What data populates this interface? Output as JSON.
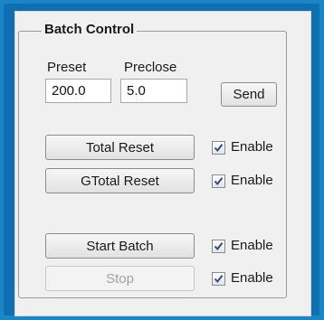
{
  "group": {
    "title": "Batch Control"
  },
  "preset": {
    "label": "Preset",
    "value": "200.0"
  },
  "preclose": {
    "label": "Preclose",
    "value": "5.0"
  },
  "buttons": {
    "send": "Send",
    "total_reset": "Total Reset",
    "gtotal_reset": "GTotal Reset",
    "start_batch": "Start Batch",
    "stop": "Stop"
  },
  "checks": [
    {
      "label": "Enable",
      "checked": true
    },
    {
      "label": "Enable",
      "checked": true
    },
    {
      "label": "Enable",
      "checked": true
    },
    {
      "label": "Enable",
      "checked": true
    }
  ],
  "colors": {
    "frame_blue": "#1a86c8",
    "check_mark": "#2b4c8c"
  }
}
